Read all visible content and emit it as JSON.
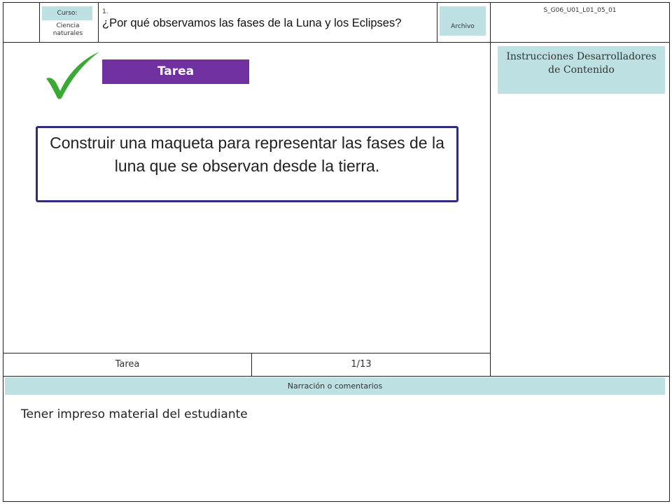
{
  "header": {
    "course_label": "Curso:",
    "course_name": "Ciencia naturales",
    "lesson_number": "1.",
    "lesson_title": "¿Por qué observamos las fases de la Luna y los Eclipses?",
    "file_label": "Archivo",
    "code": "S_G06_U01_L01_05_01"
  },
  "main": {
    "section_label": "Tarea",
    "task_text": "Construir una maqueta para representar las fases de la luna que se observan desde la tierra."
  },
  "side": {
    "instructions_title": "Instrucciones Desarrolladores de Contenido"
  },
  "footer_row": {
    "left_label": "Tarea",
    "page": "1/13"
  },
  "narration": {
    "label": "Narración o comentarios",
    "text": "Tener impreso material del estudiante"
  },
  "colors": {
    "purple": "#7030a0",
    "teal": "#bde0e3",
    "check_green": "#3aaa35",
    "box_border": "#2e2e7a"
  }
}
